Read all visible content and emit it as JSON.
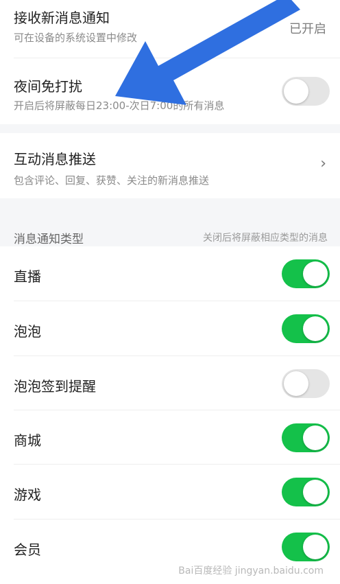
{
  "receive": {
    "title": "接收新消息通知",
    "subtitle": "可在设备的系统设置中修改",
    "status": "已开启"
  },
  "night": {
    "title": "夜间免打扰",
    "subtitle": "开启后将屏蔽每日23:00-次日7:00的所有消息",
    "enabled": false
  },
  "interactive": {
    "title": "互动消息推送",
    "subtitle": "包含评论、回复、获赞、关注的新消息推送",
    "chevron": "›"
  },
  "types_section": {
    "label": "消息通知类型",
    "hint": "关闭后将屏蔽相应类型的消息"
  },
  "types": [
    {
      "label": "直播",
      "enabled": true
    },
    {
      "label": "泡泡",
      "enabled": true
    },
    {
      "label": "泡泡签到提醒",
      "enabled": false
    },
    {
      "label": "商城",
      "enabled": true
    },
    {
      "label": "游戏",
      "enabled": true
    },
    {
      "label": "会员",
      "enabled": true
    }
  ],
  "watermark": "Bai百度经验 jingyan.baidu.com",
  "colors": {
    "toggle_on": "#14c14a",
    "toggle_off": "#e5e5e5",
    "arrow": "#2f6fe0"
  }
}
